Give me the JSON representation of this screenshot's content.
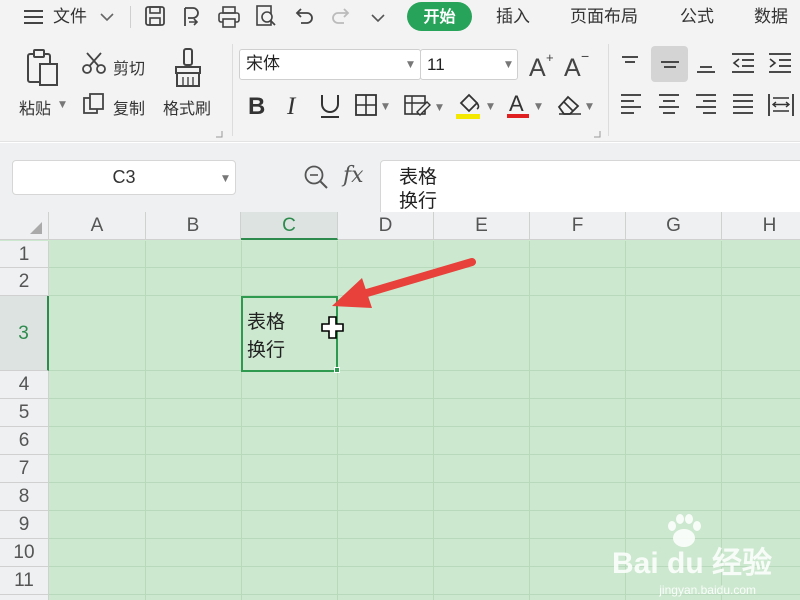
{
  "menu": {
    "file": "文件",
    "tabs": [
      "开始",
      "插入",
      "页面布局",
      "公式",
      "数据"
    ],
    "active_tab": "开始"
  },
  "ribbon": {
    "paste": "粘贴",
    "cut": "剪切",
    "copy": "复制",
    "format_painter": "格式刷",
    "font_name": "宋体",
    "font_size": "11"
  },
  "formula_bar": {
    "name_box": "C3",
    "fx": "fx",
    "content": "表格\n换行"
  },
  "sheet": {
    "columns": [
      "A",
      "B",
      "C",
      "D",
      "E",
      "F",
      "G",
      "H"
    ],
    "rows": [
      "1",
      "2",
      "3",
      "4",
      "5",
      "6",
      "7",
      "8",
      "9",
      "10",
      "11"
    ],
    "selected_col": "C",
    "selected_row": "3",
    "active_cell_text": "表格\n换行"
  },
  "watermark": {
    "brand": "Bai du 经验",
    "url": "jingyan.baidu.com"
  },
  "colors": {
    "accent": "#27a35a",
    "grid_bg": "#cce8cf",
    "arrow": "#e8403a"
  }
}
